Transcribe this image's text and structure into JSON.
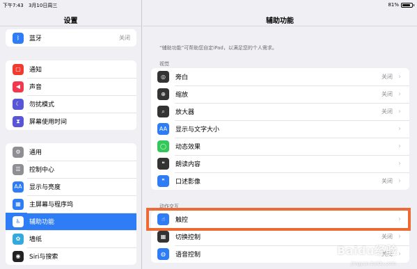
{
  "status_bar": {
    "time": "下午7:43",
    "date": "3月10日周三",
    "battery_percent": "81%",
    "battery_level": 0.81
  },
  "sidebar": {
    "title": "设置",
    "group1": [
      {
        "label": "蓝牙",
        "value": "关闭",
        "icon": "bluetooth-icon",
        "color": "#2f7df6"
      }
    ],
    "group2": [
      {
        "label": "通知",
        "icon": "notification-icon",
        "color": "#f23b30"
      },
      {
        "label": "声音",
        "icon": "sound-icon",
        "color": "#f2374f"
      },
      {
        "label": "勿扰模式",
        "icon": "moon-icon",
        "color": "#5856d6"
      },
      {
        "label": "屏幕使用时间",
        "icon": "hourglass-icon",
        "color": "#5856d6"
      }
    ],
    "group3": [
      {
        "label": "通用",
        "icon": "gear-icon",
        "color": "#8e8e93"
      },
      {
        "label": "控制中心",
        "icon": "control-center-icon",
        "color": "#8e8e93"
      },
      {
        "label": "显示与亮度",
        "icon": "display-icon",
        "color": "#2f7df6"
      },
      {
        "label": "主屏幕与程序坞",
        "icon": "home-screen-icon",
        "color": "#2f7df6"
      },
      {
        "label": "辅助功能",
        "icon": "accessibility-icon",
        "color": "#2f7df6",
        "selected": true
      },
      {
        "label": "墙纸",
        "icon": "wallpaper-icon",
        "color": "#34aadc"
      },
      {
        "label": "Siri与搜索",
        "icon": "siri-icon",
        "color": "#222222"
      }
    ]
  },
  "main": {
    "title": "辅助功能",
    "description": "“辅助功能”可帮助您自定iPad，以满足您的个人需求。",
    "vision_section": "视觉",
    "vision_items": [
      {
        "label": "旁白",
        "value": "关闭",
        "icon": "voiceover-icon",
        "color": "#333333"
      },
      {
        "label": "缩放",
        "value": "关闭",
        "icon": "zoom-icon",
        "color": "#333333"
      },
      {
        "label": "放大器",
        "value": "关闭",
        "icon": "magnifier-icon",
        "color": "#333333"
      },
      {
        "label": "显示与文字大小",
        "value": "",
        "icon": "text-size-icon",
        "color": "#2f7df6"
      },
      {
        "label": "动态效果",
        "value": "",
        "icon": "motion-icon",
        "color": "#34c759"
      },
      {
        "label": "朗读内容",
        "value": "",
        "icon": "speech-icon",
        "color": "#333333"
      },
      {
        "label": "口述影像",
        "value": "关闭",
        "icon": "audio-description-icon",
        "color": "#2f7df6"
      }
    ],
    "interaction_section": "动作交互",
    "interaction_items": [
      {
        "label": "触控",
        "value": "",
        "icon": "touch-icon",
        "color": "#2f7df6"
      },
      {
        "label": "切换控制",
        "value": "关闭",
        "icon": "switch-control-icon",
        "color": "#333333"
      },
      {
        "label": "语音控制",
        "value": "关闭",
        "icon": "voice-control-icon",
        "color": "#2f7df6"
      }
    ]
  },
  "watermark": {
    "brand": "Baidu经验",
    "sub": "jingyan.baidu.com"
  }
}
